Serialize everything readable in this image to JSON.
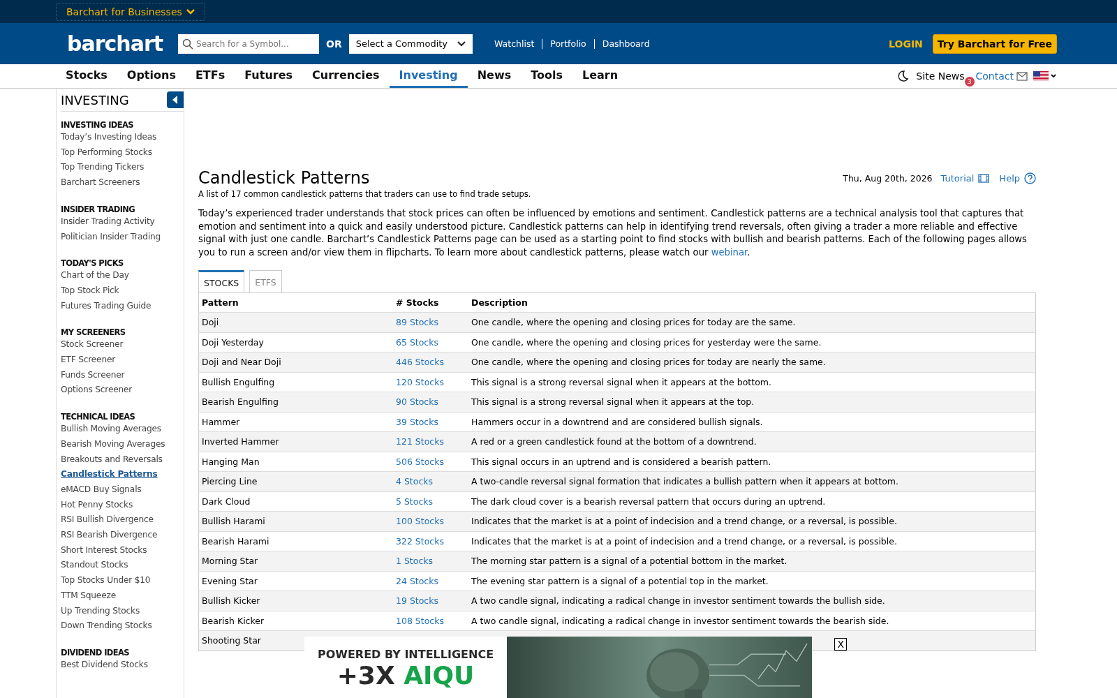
{
  "top_bar": {
    "business_menu": "Barchart for Businesses"
  },
  "header": {
    "logo": "barchart",
    "search": {
      "placeholder": "Search for a Symbol..."
    },
    "or_label": "OR",
    "commodity_select": "Select a Commodity",
    "links": [
      "Watchlist",
      "Portfolio",
      "Dashboard"
    ],
    "login": "LOGIN",
    "cta": "Try Barchart for Free"
  },
  "nav": {
    "items": [
      {
        "label": "Stocks",
        "selected": false
      },
      {
        "label": "Options",
        "selected": false
      },
      {
        "label": "ETFs",
        "selected": false
      },
      {
        "label": "Futures",
        "selected": false
      },
      {
        "label": "Currencies",
        "selected": false
      },
      {
        "label": "Investing",
        "selected": true
      },
      {
        "label": "News",
        "selected": false
      },
      {
        "label": "Tools",
        "selected": false
      },
      {
        "label": "Learn",
        "selected": false
      }
    ],
    "site_news": "Site News",
    "news_badge": "3",
    "contact": "Contact"
  },
  "sidebar": {
    "title": "INVESTING",
    "sections": [
      {
        "heading": "INVESTING IDEAS",
        "items": [
          {
            "label": "Today’s Investing Ideas",
            "selected": false
          },
          {
            "label": "Top Performing Stocks",
            "selected": false
          },
          {
            "label": "Top Trending Tickers",
            "selected": false
          },
          {
            "label": "Barchart Screeners",
            "selected": false
          }
        ]
      },
      {
        "heading": "INSIDER TRADING",
        "items": [
          {
            "label": "Insider Trading Activity",
            "selected": false
          },
          {
            "label": "Politician Insider Trading",
            "selected": false
          }
        ]
      },
      {
        "heading": "TODAY'S PICKS",
        "items": [
          {
            "label": "Chart of the Day",
            "selected": false
          },
          {
            "label": "Top Stock Pick",
            "selected": false
          },
          {
            "label": "Futures Trading Guide",
            "selected": false
          }
        ]
      },
      {
        "heading": "MY SCREENERS",
        "items": [
          {
            "label": "Stock Screener",
            "selected": false
          },
          {
            "label": "ETF Screener",
            "selected": false
          },
          {
            "label": "Funds Screener",
            "selected": false
          },
          {
            "label": "Options Screener",
            "selected": false
          }
        ]
      },
      {
        "heading": "TECHNICAL IDEAS",
        "items": [
          {
            "label": "Bullish Moving Averages",
            "selected": false
          },
          {
            "label": "Bearish Moving Averages",
            "selected": false
          },
          {
            "label": "Breakouts and Reversals",
            "selected": false
          },
          {
            "label": "Candlestick Patterns",
            "selected": true
          },
          {
            "label": "eMACD Buy Signals",
            "selected": false
          },
          {
            "label": "Hot Penny Stocks",
            "selected": false
          },
          {
            "label": "RSI Bullish Divergence",
            "selected": false
          },
          {
            "label": "RSI Bearish Divergence",
            "selected": false
          },
          {
            "label": "Short Interest Stocks",
            "selected": false
          },
          {
            "label": "Standout Stocks",
            "selected": false
          },
          {
            "label": "Top Stocks Under $10",
            "selected": false
          },
          {
            "label": "TTM Squeeze",
            "selected": false
          },
          {
            "label": "Up Trending Stocks",
            "selected": false
          },
          {
            "label": "Down Trending Stocks",
            "selected": false
          }
        ]
      },
      {
        "heading": "DIVIDEND IDEAS",
        "items": [
          {
            "label": "Best Dividend Stocks",
            "selected": false
          }
        ]
      }
    ]
  },
  "page": {
    "title": "Candlestick Patterns",
    "subtitle": "A list of 17 common candlestick patterns that traders can use to find trade setups.",
    "date": "Thu, Aug 20th, 2026",
    "tutorial": "Tutorial",
    "help": "Help",
    "intro": {
      "text": "Today’s experienced trader understands that stock prices can often be influenced by emotions and sentiment. Candlestick patterns are a technical analysis tool that captures that emotion and sentiment into a quick and easily understood picture. Candlestick patterns can help in identifying trend reversals, often giving a trader a more reliable and effective signal with just one candle. Barchart’s Candlestick Patterns page can be used as a starting point to find stocks with bullish and bearish patterns. Each of the following pages allows you to run a screen and/or view them in flipcharts. To learn more about candlestick patterns, please watch our ",
      "link": "webinar",
      "end": "."
    },
    "tabs": [
      {
        "label": "STOCKS",
        "selected": true
      },
      {
        "label": "ETFS",
        "selected": false
      }
    ],
    "table": {
      "columns": [
        "Pattern",
        "# Stocks",
        "Description"
      ],
      "rows": [
        {
          "pattern": "Doji",
          "stocks": "89 Stocks",
          "description": "One candle, where the opening and closing prices for today are the same."
        },
        {
          "pattern": "Doji Yesterday",
          "stocks": "65 Stocks",
          "description": "One candle, where the opening and closing prices for yesterday were the same."
        },
        {
          "pattern": "Doji and Near Doji",
          "stocks": "446 Stocks",
          "description": "One candle, where the opening and closing prices for today are nearly the same."
        },
        {
          "pattern": "Bullish Engulfing",
          "stocks": "120 Stocks",
          "description": "This signal is a strong reversal signal when it appears at the bottom."
        },
        {
          "pattern": "Bearish Engulfing",
          "stocks": "90 Stocks",
          "description": "This signal is a strong reversal signal when it appears at the top."
        },
        {
          "pattern": "Hammer",
          "stocks": "39 Stocks",
          "description": "Hammers occur in a downtrend and are considered bullish signals."
        },
        {
          "pattern": "Inverted Hammer",
          "stocks": "121 Stocks",
          "description": "A red or a green candlestick found at the bottom of a downtrend."
        },
        {
          "pattern": "Hanging Man",
          "stocks": "506 Stocks",
          "description": "This signal occurs in an uptrend and is considered a bearish pattern."
        },
        {
          "pattern": "Piercing Line",
          "stocks": "4 Stocks",
          "description": "A two-candle reversal signal formation that indicates a bullish pattern when it appears at bottom."
        },
        {
          "pattern": "Dark Cloud",
          "stocks": "5 Stocks",
          "description": "The dark cloud cover is a bearish reversal pattern that occurs during an uptrend."
        },
        {
          "pattern": "Bullish Harami",
          "stocks": "100 Stocks",
          "description": "Indicates that the market is at a point of indecision and a trend change, or a reversal, is possible."
        },
        {
          "pattern": "Bearish Harami",
          "stocks": "322 Stocks",
          "description": "Indicates that the market is at a point of indecision and a trend change, or a reversal, is possible."
        },
        {
          "pattern": "Morning Star",
          "stocks": "1 Stocks",
          "description": "The morning star pattern is a signal of a potential bottom in the market."
        },
        {
          "pattern": "Evening Star",
          "stocks": "24 Stocks",
          "description": "The evening star pattern is a signal of a potential top in the market."
        },
        {
          "pattern": "Bullish Kicker",
          "stocks": "19 Stocks",
          "description": "A two candle signal, indicating a radical change in investor sentiment towards the bullish side."
        },
        {
          "pattern": "Bearish Kicker",
          "stocks": "108 Stocks",
          "description": "A two candle signal, indicating a radical change in investor sentiment towards the bearish side."
        },
        {
          "pattern": "Shooting Star"
        }
      ]
    }
  },
  "ad": {
    "headline": "POWERED BY INTELLIGENCE",
    "prefix": "+3X",
    "brand": "AIQU",
    "close": "X"
  }
}
